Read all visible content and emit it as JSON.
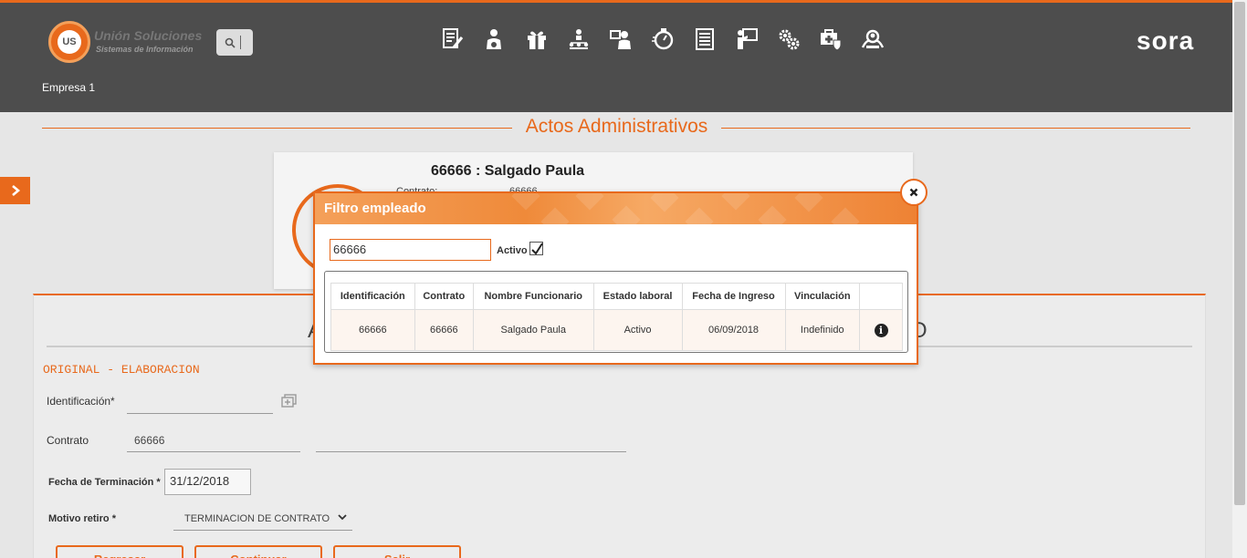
{
  "header": {
    "logo_title": "Unión Soluciones",
    "logo_subtitle": "Sistemas de Información",
    "logo_badge": "US",
    "brand": "sora",
    "company": "Empresa 1",
    "toolbar_icons": [
      "document-edit-icon",
      "person-money-icon",
      "gift-icon",
      "org-chart-icon",
      "person-id-icon",
      "stopwatch-icon",
      "list-document-icon",
      "presentation-icon",
      "gears-icon",
      "medical-shield-icon",
      "people-search-icon"
    ]
  },
  "page": {
    "title": "Actos Administrativos"
  },
  "employee_card": {
    "name": "66666 : Salgado Paula",
    "contract_label": "Contrato:",
    "contract_value": "66666"
  },
  "form": {
    "title_left": "A",
    "title_right": "O",
    "section": "ORIGINAL - ELABORACION",
    "identificacion_label": "Identificación*",
    "identificacion_value": "",
    "contrato_label": "Contrato",
    "contrato_value": "66666",
    "contrato_desc": "",
    "fecha_label": "Fecha de Terminación",
    "fecha_value": "31/12/2018",
    "motivo_label": "Motivo retiro",
    "motivo_value": "TERMINACION DE CONTRATO",
    "required_mark": "*",
    "buttons": {
      "back": "Regresar",
      "continue": "Continuar",
      "exit": "Salir"
    }
  },
  "modal": {
    "title": "Filtro empleado",
    "search_value": "66666",
    "active_label": "Activo",
    "active_checked": true,
    "columns": [
      "Identificación",
      "Contrato",
      "Nombre Funcionario",
      "Estado laboral",
      "Fecha de Ingreso",
      "Vinculación",
      ""
    ],
    "rows": [
      [
        "66666",
        "66666",
        "Salgado Paula",
        "Activo",
        "06/09/2018",
        "Indefinido"
      ]
    ]
  },
  "colors": {
    "accent": "#e8691c",
    "header_bg": "#4d4d4d",
    "page_bg": "#e6e6e6"
  }
}
